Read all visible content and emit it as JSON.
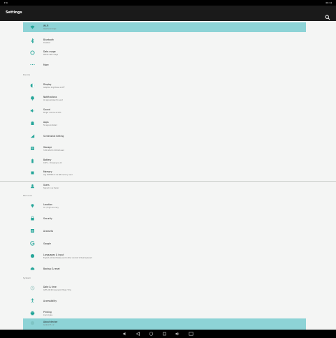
{
  "status_bar": {
    "left": "▾ ⧉",
    "right": "00:14"
  },
  "app_bar": {
    "title": "Settings",
    "search_icon": "search-icon"
  },
  "sections": {
    "device": "Device",
    "personal": "Personal",
    "system": "System"
  },
  "items": {
    "wifi": {
      "title": "Wi-Fi",
      "subtitle": "OpenSourcedge"
    },
    "bluetooth": {
      "title": "Bluetooth",
      "subtitle": "Disabled"
    },
    "data_usage": {
      "title": "Data usage",
      "subtitle": "Mobile data usage"
    },
    "more": {
      "title": "More"
    },
    "display": {
      "title": "Display",
      "subtitle": "Adaptive brightness is OFF"
    },
    "notifications": {
      "title": "Notifications",
      "subtitle": "All apps allowed to send"
    },
    "sound": {
      "title": "Sound",
      "subtitle": "Ringer volume at 50%"
    },
    "apps": {
      "title": "Apps",
      "subtitle": "56 apps installed"
    },
    "screenshot": {
      "title": "Screenshot Setting"
    },
    "storage": {
      "title": "Storage",
      "subtitle": "3.82 GB of 14.56 GB used"
    },
    "battery": {
      "title": "Battery",
      "subtitle": "100% - Charging on AC"
    },
    "memory": {
      "title": "Memory",
      "subtitle": "Avg 658 MB of 1.9 GB memory used"
    },
    "users": {
      "title": "Users",
      "subtitle": "Signed in as Owner"
    },
    "location": {
      "title": "Location",
      "subtitle": "On / High accuracy"
    },
    "security": {
      "title": "Security"
    },
    "accounts": {
      "title": "Accounts"
    },
    "google": {
      "title": "Google"
    },
    "language": {
      "title": "Languages & input",
      "subtitle": "English (United States) and 6 other Android Virtual Keyboard"
    },
    "backup": {
      "title": "Backup & reset"
    },
    "date_time": {
      "title": "Date & time",
      "subtitle": "GMT+00:00 Greenwich Mean Time"
    },
    "accessibility": {
      "title": "Accessibility"
    },
    "printing": {
      "title": "Printing",
      "subtitle": "0 print jobs"
    },
    "about": {
      "title": "About device",
      "subtitle": "Android 7.1.2"
    }
  },
  "colors": {
    "accent": "#26a69a",
    "selected": "#8dd3d6",
    "background": "#f4f5f4"
  },
  "nav_bar": {
    "buttons": [
      "volume-down-icon",
      "back-icon",
      "home-icon",
      "recents-icon",
      "volume-up-icon",
      "screenshot-icon"
    ]
  }
}
